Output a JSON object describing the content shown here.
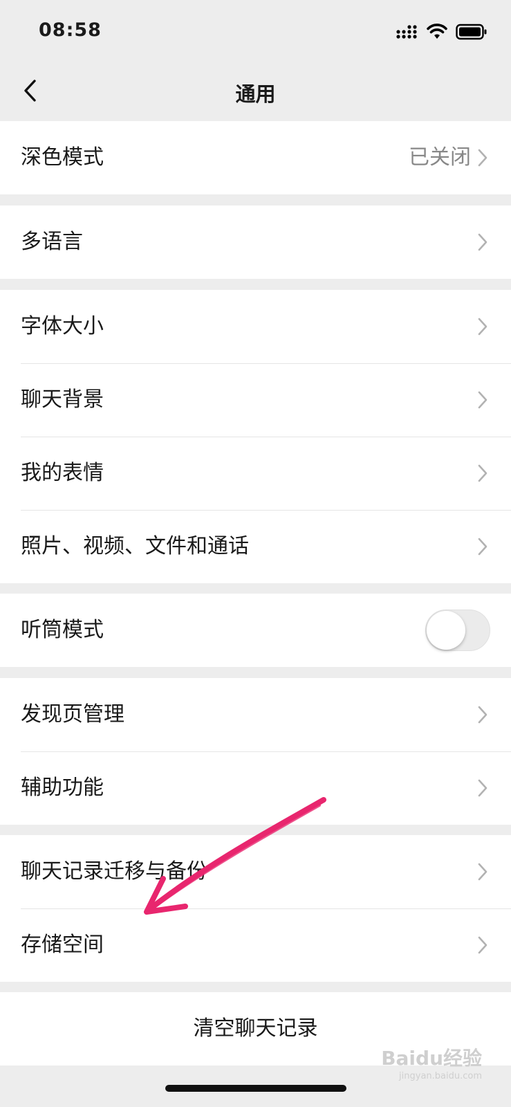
{
  "status_bar": {
    "time": "08:58"
  },
  "nav": {
    "title": "通用"
  },
  "groups": [
    {
      "items": [
        {
          "label": "深色模式",
          "value": "已关闭"
        }
      ]
    },
    {
      "items": [
        {
          "label": "多语言"
        }
      ]
    },
    {
      "items": [
        {
          "label": "字体大小"
        },
        {
          "label": "聊天背景"
        },
        {
          "label": "我的表情"
        },
        {
          "label": "照片、视频、文件和通话"
        }
      ]
    },
    {
      "items": [
        {
          "label": "听筒模式",
          "toggle": false
        }
      ]
    },
    {
      "items": [
        {
          "label": "发现页管理"
        },
        {
          "label": "辅助功能"
        }
      ]
    },
    {
      "items": [
        {
          "label": "聊天记录迁移与备份"
        },
        {
          "label": "存储空间"
        }
      ]
    }
  ],
  "clear_chat": {
    "label": "清空聊天记录"
  },
  "watermark": {
    "main": "Baidu经验",
    "sub": "jingyan.baidu.com"
  },
  "colors": {
    "annotation_arrow": "#e8266e",
    "background": "#ededed"
  }
}
